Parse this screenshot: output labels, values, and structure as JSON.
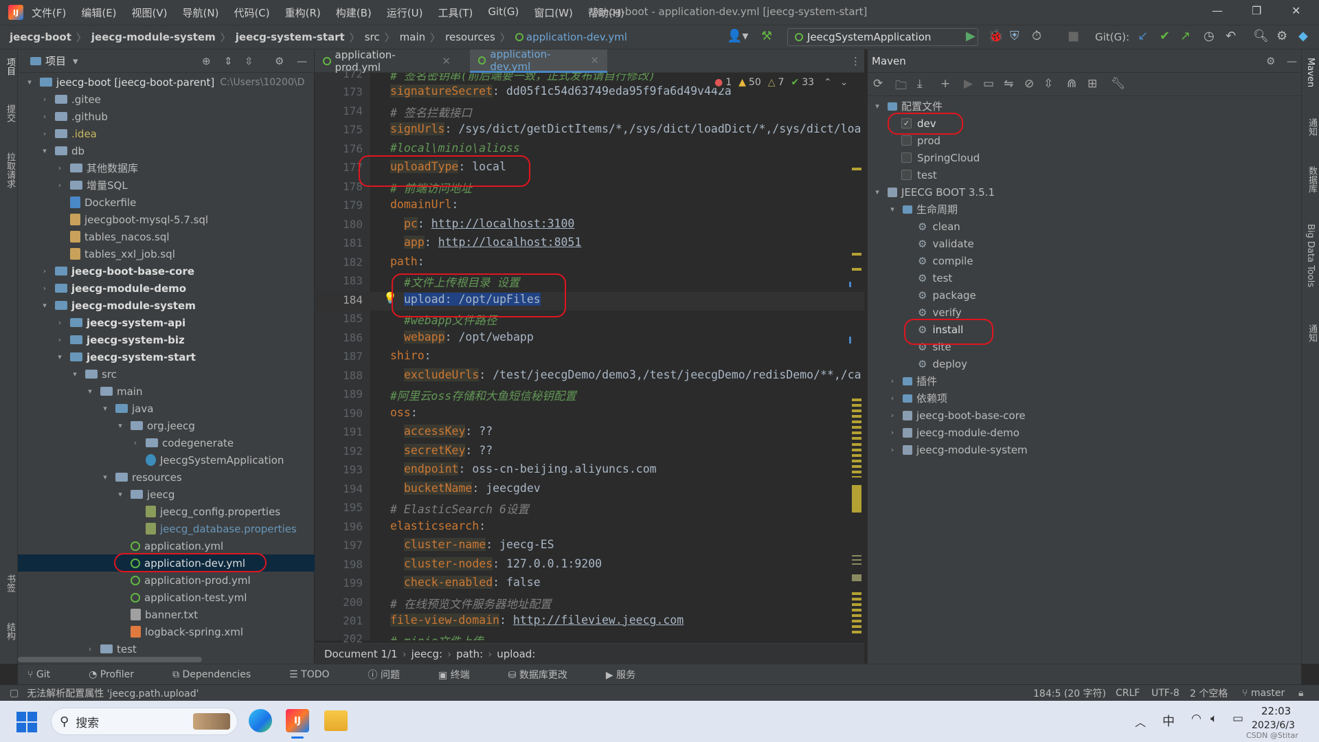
{
  "window": {
    "title": "jeecg-boot - application-dev.yml [jeecg-system-start]",
    "menu": [
      "文件(F)",
      "编辑(E)",
      "视图(V)",
      "导航(N)",
      "代码(C)",
      "重构(R)",
      "构建(B)",
      "运行(U)",
      "工具(T)",
      "Git(G)",
      "窗口(W)",
      "帮助(H)"
    ]
  },
  "nav": {
    "crumbs": [
      "jeecg-boot",
      "jeecg-module-system",
      "jeecg-system-start",
      "src",
      "main",
      "resources",
      "application-dev.yml"
    ],
    "run_config": "JeecgSystemApplication",
    "git_label": "Git(G):"
  },
  "project": {
    "header": "项目",
    "root_label": "jeecg-boot [jeecg-boot-parent]",
    "root_path": "C:\\Users\\10200\\D",
    "items": [
      ".gitee",
      ".github",
      ".idea",
      "db",
      "其他数据库",
      "增量SQL",
      "Dockerfile",
      "jeecgboot-mysql-5.7.sql",
      "tables_nacos.sql",
      "tables_xxl_job.sql",
      "jeecg-boot-base-core",
      "jeecg-module-demo",
      "jeecg-module-system",
      "jeecg-system-api",
      "jeecg-system-biz",
      "jeecg-system-start",
      "src",
      "main",
      "java",
      "org.jeecg",
      "codegenerate",
      "JeecgSystemApplication",
      "resources",
      "jeecg",
      "jeecg_config.properties",
      "jeecg_database.properties",
      "application.yml",
      "application-dev.yml",
      "application-prod.yml",
      "application-test.yml",
      "banner.txt",
      "logback-spring.xml",
      "test"
    ]
  },
  "editor": {
    "tabs": [
      "application-prod.yml",
      "application-dev.yml"
    ],
    "inspections": {
      "errors": "1",
      "warnings": "50",
      "weak": "7",
      "ok": "33"
    },
    "line_numbers": [
      "172",
      "173",
      "174",
      "175",
      "176",
      "177",
      "178",
      "179",
      "180",
      "181",
      "182",
      "183",
      "184",
      "185",
      "186",
      "187",
      "188",
      "189",
      "190",
      "191",
      "192",
      "193",
      "194",
      "195",
      "196",
      "197",
      "198",
      "199",
      "200",
      "201",
      "202"
    ],
    "lines": {
      "l172": "# 签名密钥串(前后端要一致，正式发布请自行修改)",
      "l173k": "signatureSecret",
      "l173v": ": dd05f1c54d63749eda95f9fa6d49v442a",
      "l174": "# 签名拦截接口",
      "l175k": "signUrls",
      "l175v": ": /sys/dict/getDictItems/*,/sys/dict/loadDict/*,/sys/dict/loa",
      "l176": "#local\\minio\\alioss",
      "l177k": "uploadType",
      "l177v": ": local",
      "l178": "# 前端访问地址",
      "l179k": "domainUrl",
      "l179v": ":",
      "l180k": "pc",
      "l180s": ": ",
      "l180v": "http://localhost:3100",
      "l181k": "app",
      "l181s": ": ",
      "l181v": "http://localhost:8051",
      "l182k": "path",
      "l182v": ":",
      "l183": "#文件上传根目录 设置",
      "l184k": "upload",
      "l184v": ": /opt/upFiles",
      "l185": "#webapp文件路径",
      "l186k": "webapp",
      "l186v": ": /opt/webapp",
      "l187k": "shiro",
      "l187v": ":",
      "l188k": "excludeUrls",
      "l188v": ": /test/jeecgDemo/demo3,/test/jeecgDemo/redisDemo/**,/ca",
      "l189": "#阿里云oss存储和大鱼短信秘钥配置",
      "l190k": "oss",
      "l190v": ":",
      "l191k": "accessKey",
      "l191v": ": ??",
      "l192k": "secretKey",
      "l192v": ": ??",
      "l193k": "endpoint",
      "l193v": ": oss-cn-beijing.aliyuncs.com",
      "l194k": "bucketName",
      "l194v": ": jeecgdev",
      "l195": "# ElasticSearch 6设置",
      "l196k": "elasticsearch",
      "l196v": ":",
      "l197k": "cluster-name",
      "l197v": ": jeecg-ES",
      "l198k": "cluster-nodes",
      "l198v": ": 127.0.0.1:9200",
      "l199k": "check-enabled",
      "l199v": ": false",
      "l200": "# 在线预览文件服务器地址配置",
      "l201k": "file-view-domain",
      "l201s": ": ",
      "l201v": "http://fileview.jeecg.com",
      "l202": "# minio文件上传"
    },
    "breadcrumb": [
      "Document 1/1",
      "jeecg:",
      "path:",
      "upload:"
    ]
  },
  "maven": {
    "title": "Maven",
    "profiles_label": "配置文件",
    "profiles": [
      {
        "name": "dev",
        "checked": true
      },
      {
        "name": "prod",
        "checked": false
      },
      {
        "name": "SpringCloud",
        "checked": false
      },
      {
        "name": "test",
        "checked": false
      }
    ],
    "project": "JEECG BOOT 3.5.1",
    "lifecycle_label": "生命周期",
    "lifecycle": [
      "clean",
      "validate",
      "compile",
      "test",
      "package",
      "verify",
      "install",
      "site",
      "deploy"
    ],
    "plugins_label": "插件",
    "deps_label": "依赖项",
    "modules": [
      "jeecg-boot-base-core",
      "jeecg-module-demo",
      "jeecg-module-system"
    ]
  },
  "side": {
    "left": [
      "项目",
      "提交",
      "拉取请求",
      "书签",
      "结构"
    ],
    "right": [
      "Maven",
      "通知",
      "数据库",
      "Big Data Tools",
      "通知"
    ]
  },
  "bottom_tabs": [
    "Git",
    "Profiler",
    "Dependencies",
    "TODO",
    "问题",
    "终端",
    "数据库更改",
    "服务"
  ],
  "status": {
    "message": "无法解析配置属性 'jeecg.path.upload'",
    "position": "184:5 (20 字符)",
    "line_sep": "CRLF",
    "encoding": "UTF-8",
    "indent": "2 个空格",
    "branch": "master"
  },
  "taskbar": {
    "search": "搜索",
    "ime": "中",
    "time": "22:03",
    "date": "2023/6/3",
    "watermark": "CSDN @Stitar"
  },
  "colors": {
    "accent": "#4a88c7",
    "annotation": "#e0151f",
    "key": "#cc7832",
    "comment": "#629755"
  }
}
